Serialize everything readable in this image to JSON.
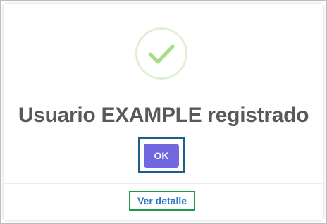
{
  "dialog": {
    "title": "Usuario EXAMPLE registrado",
    "icon": "success-check-icon",
    "confirm_label": "OK",
    "footer_link": "Ver detalle"
  },
  "colors": {
    "icon_ring": "#dff0d4",
    "check": "#a5dc86",
    "title": "#595959",
    "button_bg": "#7367e0",
    "button_focus_border": "#1b5e8a",
    "link": "#2c72c8",
    "link_focus_border": "#1f9a4a"
  }
}
